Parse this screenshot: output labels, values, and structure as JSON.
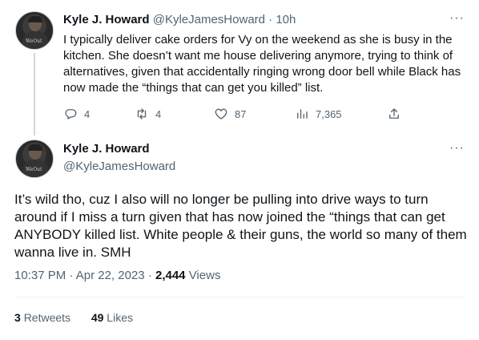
{
  "tweet1": {
    "name": "Kyle J. Howard",
    "handle": "@KyleJamesHoward",
    "separator": "·",
    "time": "10h",
    "more": "···",
    "text": "I typically deliver cake orders for Vy on the weekend as she is busy in the kitchen. She doesn’t want me house delivering anymore, trying to think of alternatives, given that accidentally ringing wrong door bell while Black has now made the “things that can get you killed” list.",
    "actions": {
      "replies": "4",
      "retweets": "4",
      "likes": "87",
      "views": "7,365"
    }
  },
  "tweet2": {
    "name": "Kyle J. Howard",
    "handle": "@KyleJamesHoward",
    "more": "···",
    "text": "It’s wild tho, cuz I also will no longer be pulling into drive ways to turn around if I miss a turn given that has now joined the “things that can get ANYBODY killed list. White people & their guns, the world so many of them wanna live in. SMH",
    "time": "10:37 PM",
    "date": "Apr 22, 2023",
    "dot": "·",
    "views_count": "2,444",
    "views_label": "Views",
    "retweets_count": "3",
    "retweets_label": "Retweets",
    "likes_count": "49",
    "likes_label": "Likes"
  },
  "avatar_logo": "WeOut",
  "colors": {
    "text": "#0f1419",
    "muted": "#536471",
    "thread_line": "#cfd9de",
    "divider": "#eff3f4"
  }
}
